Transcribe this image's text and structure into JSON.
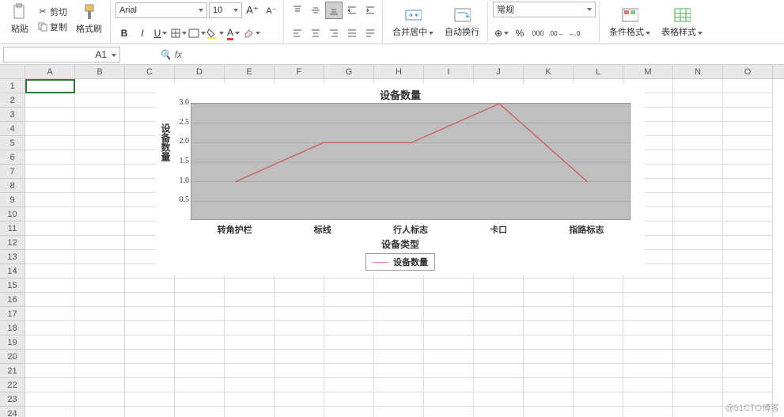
{
  "toolbar": {
    "paste": "粘贴",
    "cut": "剪切",
    "copy": "复制",
    "format_painter": "格式刷",
    "font_name": "Arial",
    "font_size": "10",
    "merge_center": "合并居中",
    "wrap_text": "自动换行",
    "number_format": "常规",
    "cond_format": "条件格式",
    "table_style": "表格样式"
  },
  "formula_bar": {
    "cell_ref": "A1",
    "fx": "fx"
  },
  "columns": [
    "A",
    "B",
    "C",
    "D",
    "E",
    "F",
    "G",
    "H",
    "I",
    "J",
    "K",
    "L",
    "M",
    "N",
    "O"
  ],
  "row_count": 24,
  "chart_data": {
    "type": "line",
    "title": "设备数量",
    "xlabel": "设备类型",
    "ylabel": "设备数量",
    "legend": "设备数量",
    "categories": [
      "转角护栏",
      "标线",
      "行人标志",
      "卡口",
      "指路标志"
    ],
    "values": [
      1.0,
      2.0,
      2.0,
      3.0,
      1.0
    ],
    "ylim": [
      0,
      3.0
    ],
    "yticks": [
      0.5,
      1.0,
      1.5,
      2.0,
      2.5,
      3.0
    ]
  },
  "watermark": "@51CTO博客"
}
